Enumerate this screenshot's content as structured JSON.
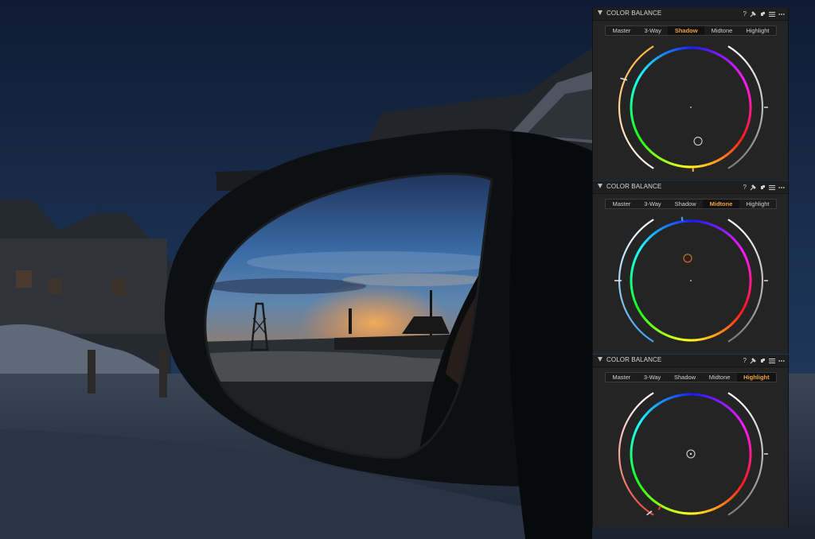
{
  "panels": [
    {
      "id": "shadow",
      "title": "COLOR BALANCE",
      "help_glyph": "?",
      "tabs": [
        "Master",
        "3-Way",
        "Shadow",
        "Midtone",
        "Highlight"
      ],
      "active_tab": "Shadow",
      "accent_color": "#f2a23a",
      "left_slider": {
        "value": 0.3,
        "gradient": [
          "#fff6ea",
          "#ffb23a"
        ]
      },
      "right_slider": {
        "value": 0.5,
        "gradient": [
          "#ffffff",
          "#7a7a7a"
        ]
      },
      "picker": {
        "hue_deg": 48,
        "amount": 0.58,
        "color": "#cfcfcf",
        "center_dot": false
      },
      "rim_tick": {
        "hue_deg": 58,
        "color": "#f2a23a"
      }
    },
    {
      "id": "midtone",
      "title": "COLOR BALANCE",
      "help_glyph": "?",
      "tabs": [
        "Master",
        "3-Way",
        "Shadow",
        "Midtone",
        "Highlight"
      ],
      "active_tab": "Midtone",
      "accent_color": "#f2a23a",
      "left_slider": {
        "value": 0.5,
        "gradient": [
          "#3ea4f0",
          "#ffffff"
        ]
      },
      "right_slider": {
        "value": 0.5,
        "gradient": [
          "#ffffff",
          "#7a7a7a"
        ]
      },
      "picker": {
        "hue_deg": 232,
        "amount": 0.38,
        "color": "#e07022",
        "center_dot": false
      },
      "rim_tick": {
        "hue_deg": 232,
        "color": "#3ea4f0"
      }
    },
    {
      "id": "highlight",
      "title": "COLOR BALANCE",
      "help_glyph": "?",
      "tabs": [
        "Master",
        "3-Way",
        "Shadow",
        "Midtone",
        "Highlight"
      ],
      "active_tab": "Highlight",
      "accent_color": "#f2a23a",
      "left_slider": {
        "value": 0.98,
        "gradient": [
          "#e8483a",
          "#ffffff"
        ]
      },
      "right_slider": {
        "value": 0.5,
        "gradient": [
          "#ffffff",
          "#7a7a7a"
        ]
      },
      "picker": {
        "hue_deg": 0,
        "amount": 0.0,
        "color": "#d6d6d6",
        "center_dot": true
      },
      "rim_tick": {
        "hue_deg": 90,
        "color": "#ff2a2a"
      }
    }
  ]
}
